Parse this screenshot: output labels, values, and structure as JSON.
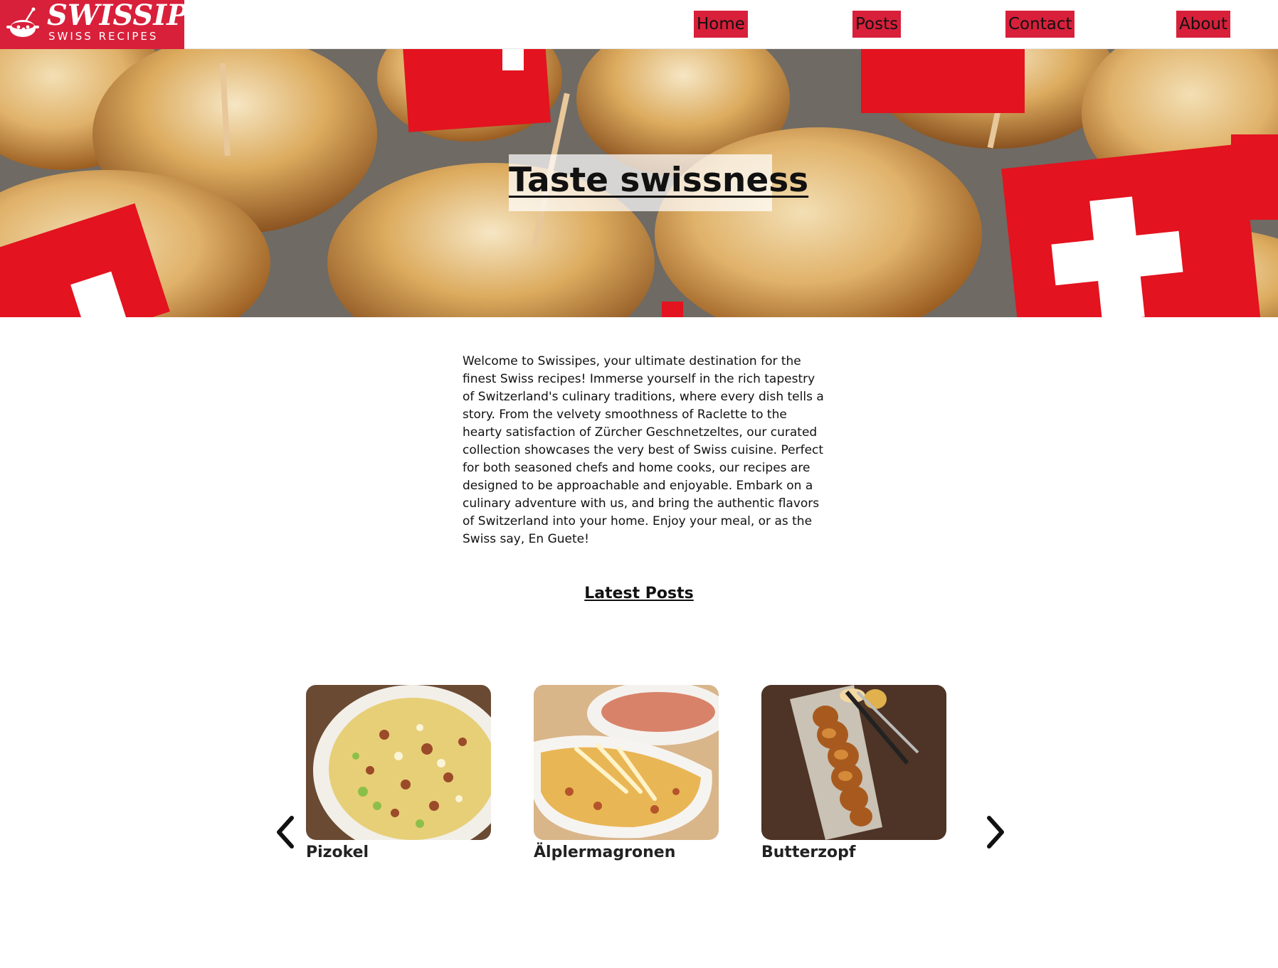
{
  "brand": {
    "name": "SWISSIPES",
    "tagline": "SWISS RECIPES",
    "color": "#d8203b"
  },
  "nav": {
    "items": [
      {
        "label": "Home"
      },
      {
        "label": "Posts"
      },
      {
        "label": "Contact"
      },
      {
        "label": "About"
      }
    ]
  },
  "hero": {
    "title": "Taste swissness",
    "image": "swiss-bread-rolls-with-flags"
  },
  "intro": {
    "text": "Welcome to Swissipes, your ultimate destination for the finest Swiss recipes! Immerse yourself in the rich tapestry of Switzerland's culinary traditions, where every dish tells a story. From the velvety smoothness of Raclette to the hearty satisfaction of Zürcher Geschnetzeltes, our curated collection showcases the very best of Swiss cuisine. Perfect for both seasoned chefs and home cooks, our recipes are designed to be approachable and enjoyable. Embark on a culinary adventure with us, and bring the authentic flavors of Switzerland into your home. Enjoy your meal, or as the Swiss say, En Guete!"
  },
  "latest": {
    "heading": "Latest Posts",
    "prev_icon": "chevron-left-icon",
    "next_icon": "chevron-right-icon",
    "posts": [
      {
        "title": "Pizokel",
        "image": "pizokel-dish"
      },
      {
        "title": "Älplermagronen",
        "image": "alplermagronen-dish"
      },
      {
        "title": "Butterzopf",
        "image": "butterzopf-bread"
      }
    ]
  }
}
